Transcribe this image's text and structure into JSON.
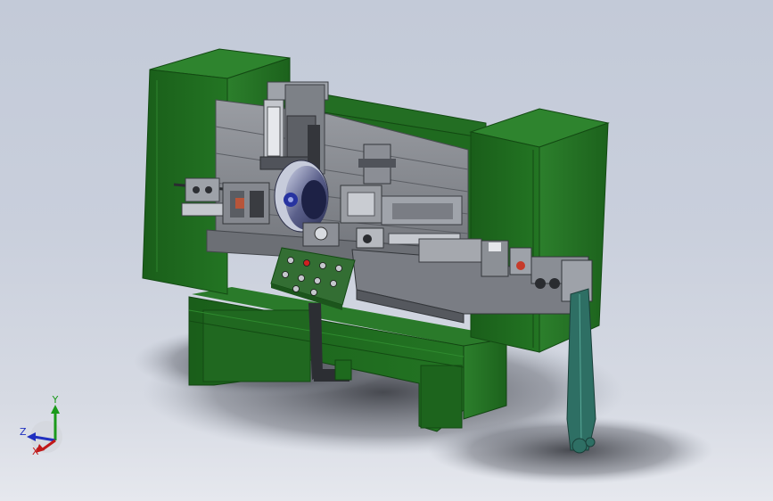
{
  "viewport": {
    "background_top": "#c3cad8",
    "background_bottom": "#e6e8ee"
  },
  "model": {
    "frame_color": "#1f6b1f",
    "plate_color": "#8a8d93",
    "panel_color": "#2f6a2f"
  },
  "control_panel": {
    "button_colors": [
      "#c4c7cc",
      "#d02020",
      "#c4c7cc",
      "#c4c7cc",
      "#c4c7cc",
      "#c4c7cc",
      "#c4c7cc",
      "#c4c7cc",
      "#c4c7cc",
      "#c4c7cc"
    ]
  },
  "triad": {
    "y_label": "Y",
    "z_label": "Z",
    "x_label": "X",
    "y_color": "#1a9a1a",
    "z_color": "#2030c0",
    "x_color": "#c01818"
  }
}
